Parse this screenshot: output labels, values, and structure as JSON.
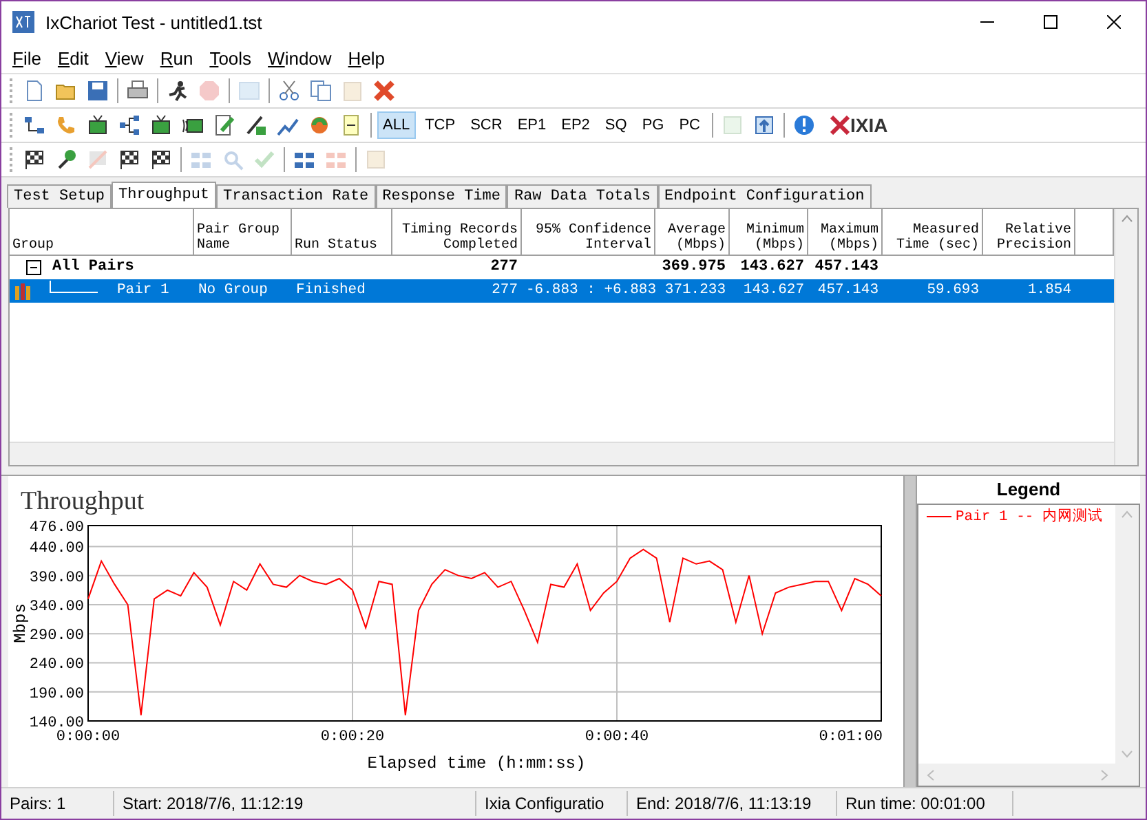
{
  "window": {
    "title": "IxChariot Test - untitled1.tst"
  },
  "menu": [
    {
      "label": "File"
    },
    {
      "label": "Edit"
    },
    {
      "label": "View"
    },
    {
      "label": "Run"
    },
    {
      "label": "Tools"
    },
    {
      "label": "Window"
    },
    {
      "label": "Help"
    }
  ],
  "toolbars": [
    [
      [
        {
          "kind": "icon",
          "disabled": false
        },
        {
          "kind": "icon",
          "disabled": false
        },
        {
          "kind": "icon",
          "disabled": false
        }
      ],
      [
        {
          "kind": "icon",
          "disabled": false
        }
      ],
      [
        {
          "kind": "icon",
          "disabled": false
        },
        {
          "kind": "icon",
          "disabled": true
        }
      ],
      [
        {
          "kind": "icon",
          "disabled": true
        }
      ],
      [
        {
          "kind": "icon",
          "disabled": false
        },
        {
          "kind": "icon",
          "disabled": false
        },
        {
          "kind": "icon",
          "disabled": true
        },
        {
          "kind": "icon",
          "disabled": false
        }
      ]
    ],
    [
      [
        {
          "kind": "icon",
          "disabled": false
        },
        {
          "kind": "icon",
          "disabled": false
        },
        {
          "kind": "icon",
          "disabled": false
        },
        {
          "kind": "icon",
          "disabled": false
        },
        {
          "kind": "icon",
          "disabled": false
        },
        {
          "kind": "icon",
          "disabled": false
        },
        {
          "kind": "icon",
          "disabled": false
        },
        {
          "kind": "icon",
          "disabled": false
        },
        {
          "kind": "icon",
          "disabled": false
        },
        {
          "kind": "icon",
          "disabled": false
        },
        {
          "kind": "icon",
          "disabled": false
        }
      ],
      [
        {
          "kind": "toggle",
          "label": "ALL",
          "selected": true
        },
        {
          "kind": "toggle",
          "label": "TCP",
          "selected": false
        },
        {
          "kind": "toggle",
          "label": "SCR",
          "selected": false
        },
        {
          "kind": "toggle",
          "label": "EP1",
          "selected": false
        },
        {
          "kind": "toggle",
          "label": "EP2",
          "selected": false
        },
        {
          "kind": "toggle",
          "label": "SQ",
          "selected": false
        },
        {
          "kind": "toggle",
          "label": "PG",
          "selected": false
        },
        {
          "kind": "toggle",
          "label": "PC",
          "selected": false
        }
      ],
      [
        {
          "kind": "icon",
          "disabled": true
        },
        {
          "kind": "icon",
          "disabled": false
        }
      ],
      [
        {
          "kind": "icon",
          "disabled": false
        },
        {
          "kind": "logo",
          "label": "IXIA"
        }
      ]
    ],
    [
      [
        {
          "kind": "icon",
          "disabled": false
        },
        {
          "kind": "icon",
          "disabled": false
        },
        {
          "kind": "icon",
          "disabled": true
        },
        {
          "kind": "icon",
          "disabled": false
        },
        {
          "kind": "icon",
          "disabled": false
        }
      ],
      [
        {
          "kind": "icon",
          "disabled": true
        },
        {
          "kind": "icon",
          "disabled": true
        },
        {
          "kind": "icon",
          "disabled": true
        }
      ],
      [
        {
          "kind": "icon",
          "disabled": false
        },
        {
          "kind": "icon",
          "disabled": true
        }
      ],
      [
        {
          "kind": "icon",
          "disabled": true
        }
      ]
    ]
  ],
  "tabs": [
    {
      "label": "Test Setup",
      "selected": false
    },
    {
      "label": "Throughput",
      "selected": true
    },
    {
      "label": "Transaction Rate",
      "selected": false
    },
    {
      "label": "Response Time",
      "selected": false
    },
    {
      "label": "Raw Data Totals",
      "selected": false
    },
    {
      "label": "Endpoint Configuration",
      "selected": false
    }
  ],
  "table": {
    "columns": [
      "Group",
      "Pair Group Name",
      "Run Status",
      "Timing Records Completed",
      "95% Confidence Interval",
      "Average (Mbps)",
      "Minimum (Mbps)",
      "Maximum (Mbps)",
      "Measured Time (sec)",
      "Relative Precision"
    ],
    "rows": [
      {
        "group": "All Pairs",
        "expanded": true,
        "selected": false,
        "timing_records_completed": "277",
        "average": "369.975",
        "minimum": "143.627",
        "maximum": "457.143",
        "children": [
          {
            "group": "Pair 1",
            "pair_group_name": "No Group",
            "run_status": "Finished",
            "timing_records_completed": "277",
            "confidence_interval": "-6.883 : +6.883",
            "average": "371.233",
            "minimum": "143.627",
            "maximum": "457.143",
            "measured_time": "59.693",
            "relative_precision": "1.854",
            "selected": true
          }
        ]
      }
    ]
  },
  "chart": {
    "chart_data": {
      "type": "line",
      "title": "Throughput",
      "xlabel": "Elapsed time (h:mm:ss)",
      "ylabel": "Mbps",
      "x": [
        0,
        1,
        2,
        3,
        4,
        5,
        6,
        7,
        8,
        9,
        10,
        11,
        12,
        13,
        14,
        15,
        16,
        17,
        18,
        19,
        20,
        21,
        22,
        23,
        24,
        25,
        26,
        27,
        28,
        29,
        30,
        31,
        32,
        33,
        34,
        35,
        36,
        37,
        38,
        39,
        40,
        41,
        42,
        43,
        44,
        45,
        46,
        47,
        48,
        49,
        50,
        51,
        52,
        53,
        54,
        55,
        56,
        57,
        58,
        59,
        60
      ],
      "series": [
        {
          "name": "Pair 1 -- 内网测试",
          "color": "#ff0000",
          "values": [
            350,
            415,
            375,
            340,
            150,
            350,
            365,
            355,
            395,
            370,
            305,
            380,
            365,
            410,
            375,
            370,
            390,
            380,
            375,
            385,
            365,
            300,
            380,
            375,
            150,
            330,
            375,
            400,
            390,
            385,
            395,
            370,
            380,
            330,
            275,
            375,
            370,
            410,
            330,
            360,
            380,
            420,
            435,
            420,
            310,
            420,
            410,
            415,
            400,
            310,
            390,
            290,
            360,
            370,
            375,
            380,
            380,
            330,
            385,
            375,
            355
          ]
        }
      ],
      "xlim": [
        0,
        60
      ],
      "ylim": [
        140,
        476
      ],
      "grid": true,
      "xticks": [
        {
          "value": 0,
          "label": "0:00:00"
        },
        {
          "value": 20,
          "label": "0:00:20"
        },
        {
          "value": 40,
          "label": "0:00:40"
        },
        {
          "value": 60,
          "label": "0:01:00"
        }
      ],
      "yticks": [
        {
          "value": 140,
          "label": "140.00"
        },
        {
          "value": 190,
          "label": "190.00"
        },
        {
          "value": 240,
          "label": "240.00"
        },
        {
          "value": 290,
          "label": "290.00"
        },
        {
          "value": 340,
          "label": "340.00"
        },
        {
          "value": 390,
          "label": "390.00"
        },
        {
          "value": 440,
          "label": "440.00"
        },
        {
          "value": 476,
          "label": "476.00"
        }
      ]
    }
  },
  "legend": {
    "title": "Legend"
  },
  "status_bar": [
    {
      "text": "Pairs: 1"
    },
    {
      "text": "Start: 2018/7/6, 11:12:19"
    },
    {
      "text": "Ixia Configuratio"
    },
    {
      "text": "End: 2018/7/6, 11:13:19"
    },
    {
      "text": "Run time: 00:01:00"
    }
  ]
}
